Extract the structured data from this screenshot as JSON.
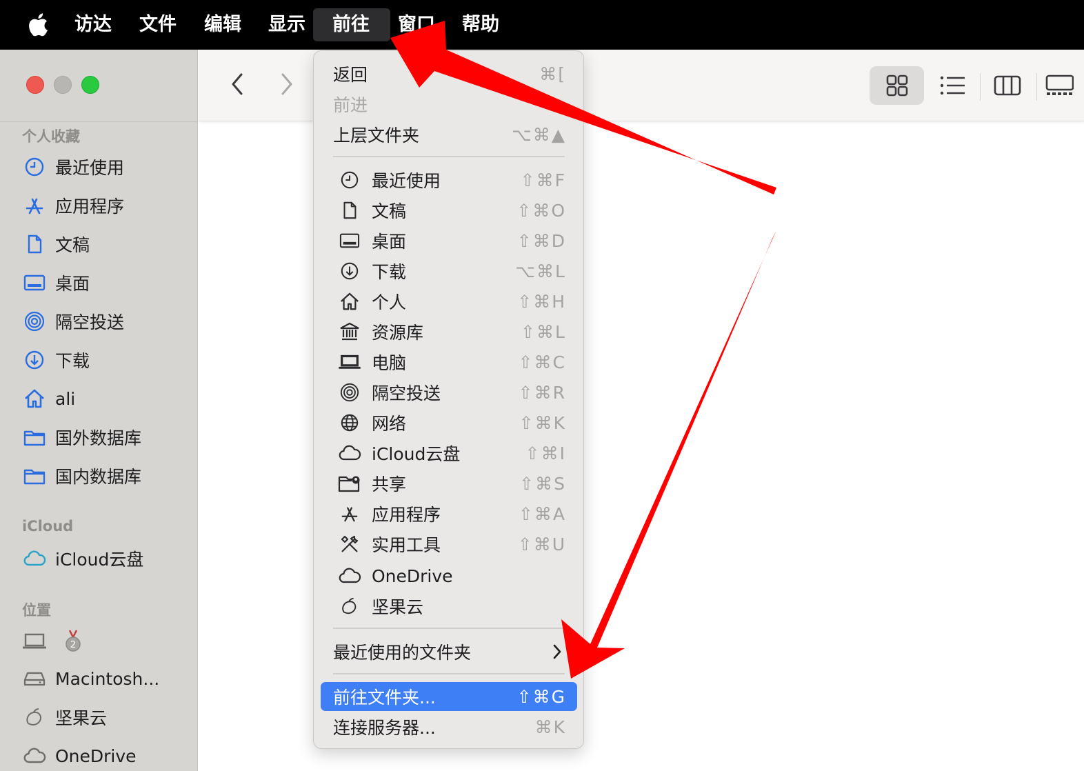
{
  "menubar": {
    "app": "访达",
    "items": [
      "文件",
      "编辑",
      "显示",
      "前往",
      "窗口",
      "帮助"
    ],
    "active": "前往"
  },
  "sidebar": {
    "favorites_header": "个人收藏",
    "favorites": [
      {
        "label": "最近使用",
        "icon": "clock-icon"
      },
      {
        "label": "应用程序",
        "icon": "applications-icon"
      },
      {
        "label": "文稿",
        "icon": "document-icon"
      },
      {
        "label": "桌面",
        "icon": "desktop-icon"
      },
      {
        "label": "隔空投送",
        "icon": "airdrop-icon"
      },
      {
        "label": "下载",
        "icon": "download-icon"
      },
      {
        "label": "ali",
        "icon": "home-icon"
      },
      {
        "label": "国外数据库",
        "icon": "folder-icon"
      },
      {
        "label": "国内数据库",
        "icon": "folder-icon"
      }
    ],
    "icloud_header": "iCloud",
    "icloud": [
      {
        "label": "iCloud云盘",
        "icon": "cloud-icon"
      }
    ],
    "locations_header": "位置",
    "locations": [
      {
        "label": "",
        "icon": "laptop-icon"
      },
      {
        "label": "Macintosh...",
        "icon": "disk-icon"
      },
      {
        "label": "坚果云",
        "icon": "nutstore-icon"
      },
      {
        "label": "OneDrive",
        "icon": "cloud-icon"
      }
    ]
  },
  "go_menu": {
    "nav": [
      {
        "label": "返回",
        "shortcut": "⌘[",
        "disabled": false
      },
      {
        "label": "前进",
        "shortcut": "",
        "disabled": true
      },
      {
        "label": "上层文件夹",
        "shortcut": "⌥⌘▲",
        "disabled": false
      }
    ],
    "places": [
      {
        "label": "最近使用",
        "shortcut": "⇧⌘F",
        "icon": "clock-icon"
      },
      {
        "label": "文稿",
        "shortcut": "⇧⌘O",
        "icon": "document-icon"
      },
      {
        "label": "桌面",
        "shortcut": "⇧⌘D",
        "icon": "desktop-icon"
      },
      {
        "label": "下载",
        "shortcut": "⌥⌘L",
        "icon": "download-icon"
      },
      {
        "label": "个人",
        "shortcut": "⇧⌘H",
        "icon": "home-icon"
      },
      {
        "label": "资源库",
        "shortcut": "⇧⌘L",
        "icon": "library-icon"
      },
      {
        "label": "电脑",
        "shortcut": "⇧⌘C",
        "icon": "laptop-icon"
      },
      {
        "label": "隔空投送",
        "shortcut": "⇧⌘R",
        "icon": "airdrop-icon"
      },
      {
        "label": "网络",
        "shortcut": "⇧⌘K",
        "icon": "globe-icon"
      },
      {
        "label": "iCloud云盘",
        "shortcut": "⇧⌘I",
        "icon": "cloud-icon"
      },
      {
        "label": "共享",
        "shortcut": "⇧⌘S",
        "icon": "shared-folder-icon"
      },
      {
        "label": "应用程序",
        "shortcut": "⇧⌘A",
        "icon": "applications-icon"
      },
      {
        "label": "实用工具",
        "shortcut": "⇧⌘U",
        "icon": "tools-icon"
      },
      {
        "label": "OneDrive",
        "shortcut": "",
        "icon": "cloud-icon"
      },
      {
        "label": "坚果云",
        "shortcut": "",
        "icon": "nutstore-icon"
      }
    ],
    "recent_folders": "最近使用的文件夹",
    "go_to_folder": {
      "label": "前往文件夹...",
      "shortcut": "⇧⌘G"
    },
    "connect_server": {
      "label": "连接服务器...",
      "shortcut": "⌘K"
    }
  },
  "colors": {
    "accent": "#3e7ff5",
    "sidebar_icon": "#2a6de0",
    "arrow": "#ff0000"
  }
}
